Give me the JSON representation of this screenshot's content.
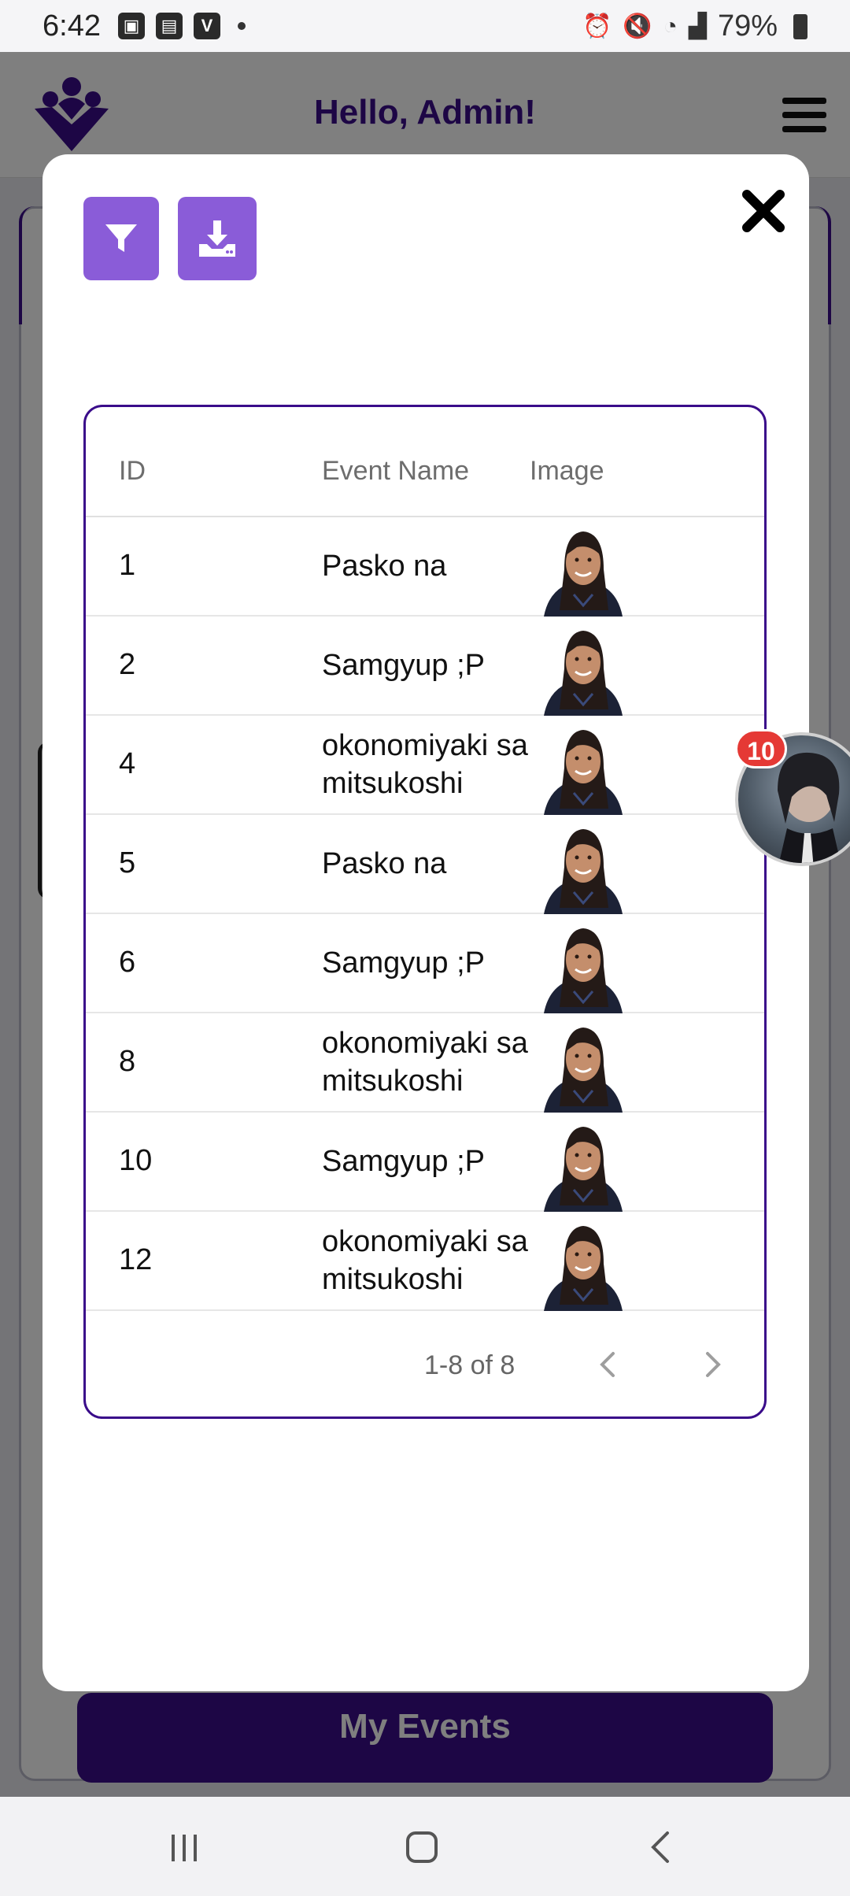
{
  "status_bar": {
    "time": "6:42",
    "battery": "79%",
    "icons_left": [
      "gallery-icon",
      "twitch-icon",
      "vimeo-icon"
    ],
    "icons_right": [
      "alarm-icon",
      "mute-icon",
      "wifi-icon",
      "signal-icon",
      "battery-icon"
    ]
  },
  "app": {
    "header_title": "Hello, Admin!",
    "primary_button_label": "My Events",
    "brand_color": "#3a0c8a"
  },
  "modal": {
    "filter_icon": "filter-icon",
    "download_icon": "download-icon",
    "close_icon": "close-icon",
    "accent_color": "#8a5cd8"
  },
  "table": {
    "columns": [
      "ID",
      "Event Name",
      "Image"
    ],
    "rows": [
      {
        "id": "1",
        "name": "Pasko na",
        "image": "profile-photo"
      },
      {
        "id": "2",
        "name": "Samgyup ;P",
        "image": "profile-photo"
      },
      {
        "id": "4",
        "name": "okonomiyaki sa mitsukoshi",
        "image": "profile-photo"
      },
      {
        "id": "5",
        "name": "Pasko na",
        "image": "profile-photo"
      },
      {
        "id": "6",
        "name": "Samgyup ;P",
        "image": "profile-photo"
      },
      {
        "id": "8",
        "name": "okonomiyaki sa mitsukoshi",
        "image": "profile-photo"
      },
      {
        "id": "10",
        "name": "Samgyup ;P",
        "image": "profile-photo"
      },
      {
        "id": "12",
        "name": "okonomiyaki sa mitsukoshi",
        "image": "profile-photo"
      }
    ],
    "pagination": {
      "label": "1-8 of 8"
    }
  },
  "chat_head": {
    "badge_count": "10"
  },
  "nav_bar": {
    "items": [
      "recents-icon",
      "home-icon",
      "back-icon"
    ]
  }
}
